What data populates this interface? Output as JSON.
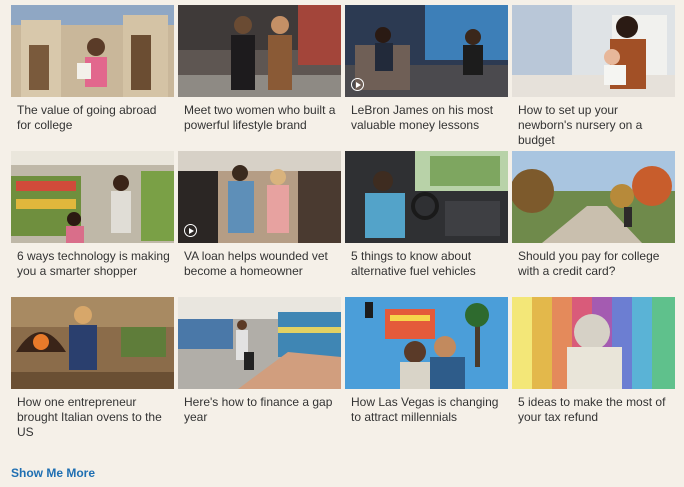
{
  "articles": [
    {
      "title": "The value of going abroad for college",
      "video": false
    },
    {
      "title": "Meet two women who built a powerful lifestyle brand",
      "video": false
    },
    {
      "title": "LeBron James on his most valuable money lessons",
      "video": true
    },
    {
      "title": "How to set up your newborn's nursery on a budget",
      "video": false
    },
    {
      "title": "6 ways technology is making you a smarter shopper",
      "video": false
    },
    {
      "title": "VA loan helps wounded vet become a homeowner",
      "video": true
    },
    {
      "title": "5 things to know about alternative fuel vehicles",
      "video": false
    },
    {
      "title": "Should you pay for college with a credit card?",
      "video": false
    },
    {
      "title": "How one entrepreneur brought Italian ovens to the US",
      "video": false
    },
    {
      "title": "Here's how to finance a gap year",
      "video": false
    },
    {
      "title": "How Las Vegas is changing to attract millennials",
      "video": false
    },
    {
      "title": "5 ideas to make the most of your tax refund",
      "video": false
    }
  ],
  "show_more_label": "Show Me More",
  "colors": {
    "link": "#1f6fb2",
    "background": "#f5f0e8",
    "text": "#333333"
  }
}
